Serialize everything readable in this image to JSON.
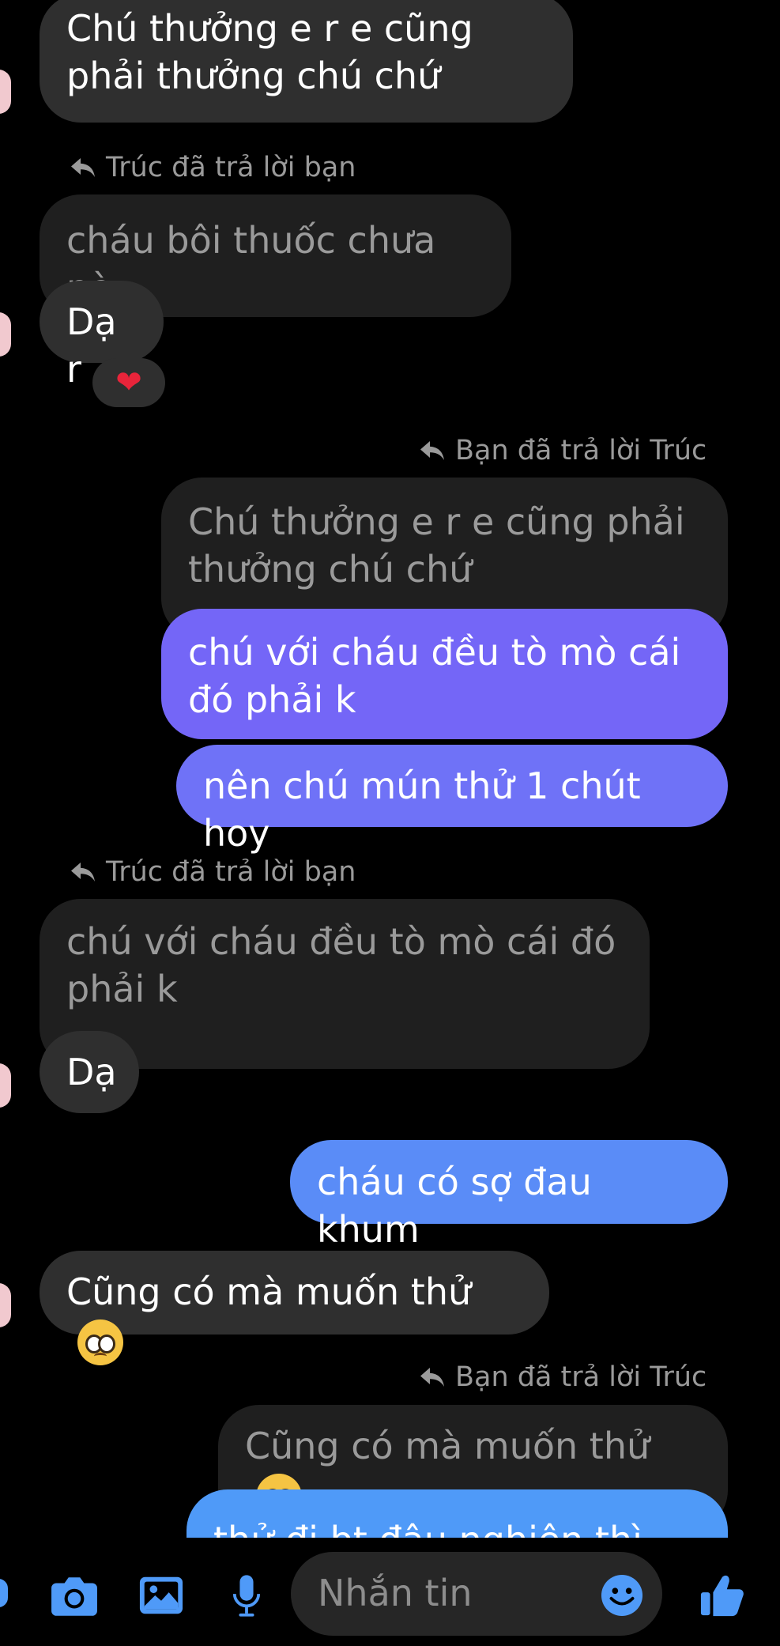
{
  "messages": {
    "m1": "Chú thưởng e r e cũng phải thưởng chú chứ",
    "reply1_note": "Trúc đã trả lời bạn",
    "m2_quote": "cháu bôi thuốc chưa nè",
    "m2": "Dạ r",
    "reaction": "❤",
    "reply2_note": "Bạn đã trả lời Trúc",
    "m3_quote": "Chú thưởng e r e cũng phải thưởng chú chứ",
    "m3": "chú với cháu đều tò mò cái đó phải k",
    "m4": "nên chú mún thử 1 chút hoy",
    "reply3_note": "Trúc đã trả lời bạn",
    "m5_quote": "chú với cháu đều tò mò cái đó phải k",
    "m5": "Dạ",
    "m6": "cháu có sợ đau khum",
    "m7": "Cũng có mà muốn thử",
    "reply4_note": "Bạn đã trả lời Trúc",
    "m8_quote": "Cũng có mà muốn thử",
    "m8": "thử đi bt đâu nghiện thì sao"
  },
  "composer": {
    "placeholder": "Nhắn tin",
    "icons": [
      "camera-icon",
      "image-icon",
      "microphone-icon",
      "emoji-icon",
      "like-icon"
    ]
  },
  "colors": {
    "background": "#000000",
    "incoming": "#2f2f2f",
    "quote": "#1f1f1f",
    "outgoing_purple": "#7466f7",
    "outgoing_blue": "#5a8cf7",
    "accent": "#4f9af8"
  }
}
